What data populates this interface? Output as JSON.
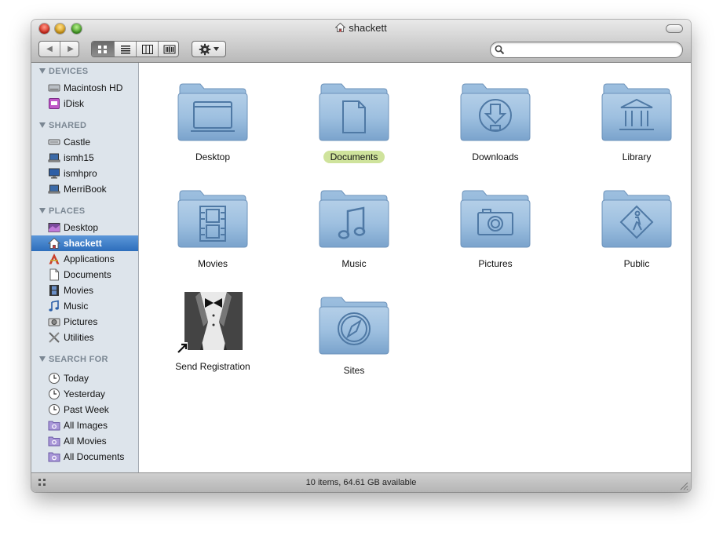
{
  "window": {
    "title": "shackett"
  },
  "toolbar": {
    "back_label": "◀",
    "forward_label": "▶",
    "view_modes": [
      "icon-view",
      "list-view",
      "column-view",
      "cover-flow-view"
    ],
    "active_view": "icon-view",
    "search": {
      "placeholder": "",
      "value": ""
    }
  },
  "sidebar": {
    "devices": {
      "heading": "DEVICES",
      "items": [
        {
          "label": "Macintosh HD",
          "icon": "hard-disk-icon"
        },
        {
          "label": "iDisk",
          "icon": "idisk-icon"
        }
      ]
    },
    "shared": {
      "heading": "SHARED",
      "items": [
        {
          "label": "Castle",
          "icon": "server-icon"
        },
        {
          "label": "ismh15",
          "icon": "computer-icon"
        },
        {
          "label": "ismhpro",
          "icon": "computer-icon"
        },
        {
          "label": "MerriBook",
          "icon": "computer-icon"
        }
      ]
    },
    "places": {
      "heading": "PLACES",
      "items": [
        {
          "label": "Desktop",
          "icon": "desktop-icon"
        },
        {
          "label": "shackett",
          "icon": "home-icon"
        },
        {
          "label": "Applications",
          "icon": "applications-icon"
        },
        {
          "label": "Documents",
          "icon": "document-icon"
        },
        {
          "label": "Movies",
          "icon": "movies-icon"
        },
        {
          "label": "Music",
          "icon": "music-icon"
        },
        {
          "label": "Pictures",
          "icon": "camera-icon"
        },
        {
          "label": "Utilities",
          "icon": "utilities-icon"
        }
      ],
      "selected": "shackett"
    },
    "search_for": {
      "heading": "SEARCH FOR",
      "items": [
        {
          "label": "Today",
          "icon": "clock-icon"
        },
        {
          "label": "Yesterday",
          "icon": "clock-icon"
        },
        {
          "label": "Past Week",
          "icon": "clock-icon"
        },
        {
          "label": "All Images",
          "icon": "smart-folder-icon"
        },
        {
          "label": "All Movies",
          "icon": "smart-folder-icon"
        },
        {
          "label": "All Documents",
          "icon": "smart-folder-icon"
        }
      ]
    }
  },
  "main": {
    "items": [
      {
        "label": "Desktop",
        "icon": "desktop-folder-icon"
      },
      {
        "label": "Documents",
        "icon": "documents-folder-icon"
      },
      {
        "label": "Downloads",
        "icon": "downloads-folder-icon"
      },
      {
        "label": "Library",
        "icon": "library-folder-icon"
      },
      {
        "label": "Movies",
        "icon": "movies-folder-icon"
      },
      {
        "label": "Music",
        "icon": "music-folder-icon"
      },
      {
        "label": "Pictures",
        "icon": "pictures-folder-icon"
      },
      {
        "label": "Public",
        "icon": "public-folder-icon"
      },
      {
        "label": "Send Registration",
        "icon": "send-registration-alias-icon"
      },
      {
        "label": "Sites",
        "icon": "sites-folder-icon"
      }
    ],
    "selected": "Documents"
  },
  "status": {
    "text": "10 items, 64.61 GB available"
  },
  "colors": {
    "folder_blue": "#8fb3d6",
    "sidebar_bg": "#dde4eb",
    "selection_blue": "#3a7bc8",
    "label_highlight": "#cfe39c"
  }
}
